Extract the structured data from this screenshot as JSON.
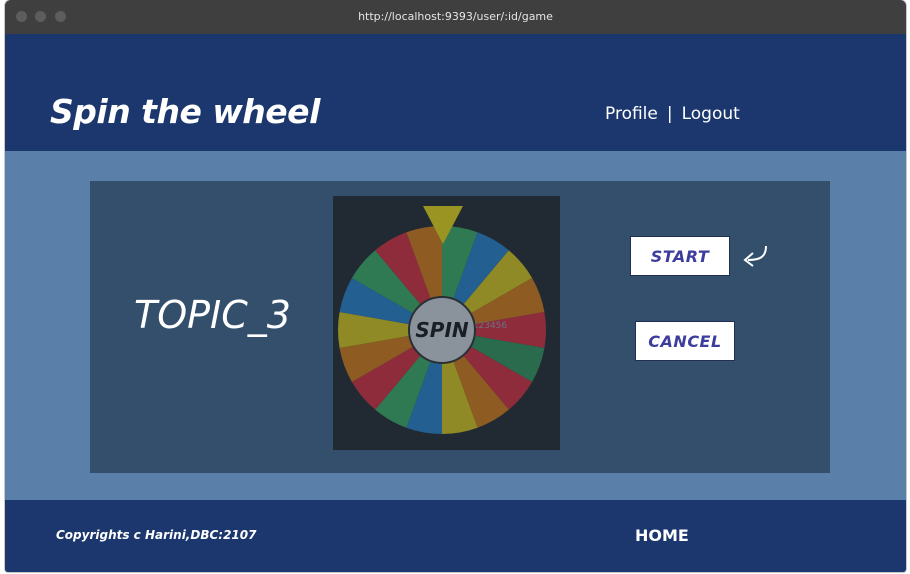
{
  "browser": {
    "url": "http://localhost:9393/user/:id/game"
  },
  "header": {
    "brand": "Spin the wheel",
    "nav": {
      "profile": "Profile",
      "separator": "|",
      "logout": "Logout"
    }
  },
  "game": {
    "topic": "TOPIC_3",
    "wheel": {
      "spin_label": "SPIN",
      "hint_text": "Hello World! 123456",
      "segment_colors": [
        "#2f7a52",
        "#245f92",
        "#8f8a25",
        "#8e5b22",
        "#8e2c3c",
        "#2a6a4d",
        "#8e2c3c",
        "#8e5b22",
        "#8f8a25",
        "#245f92",
        "#2f7a52",
        "#8e2c3c",
        "#8e5b22",
        "#8f8a25",
        "#245f92",
        "#2f7a52",
        "#8e2c3c",
        "#8e5b22"
      ],
      "pointer_color": "#9a9422"
    },
    "start_label": "START",
    "cancel_label": "CANCEL"
  },
  "footer": {
    "copyright": "Copyrights c Harini,DBC:2107",
    "home": "HOME"
  }
}
